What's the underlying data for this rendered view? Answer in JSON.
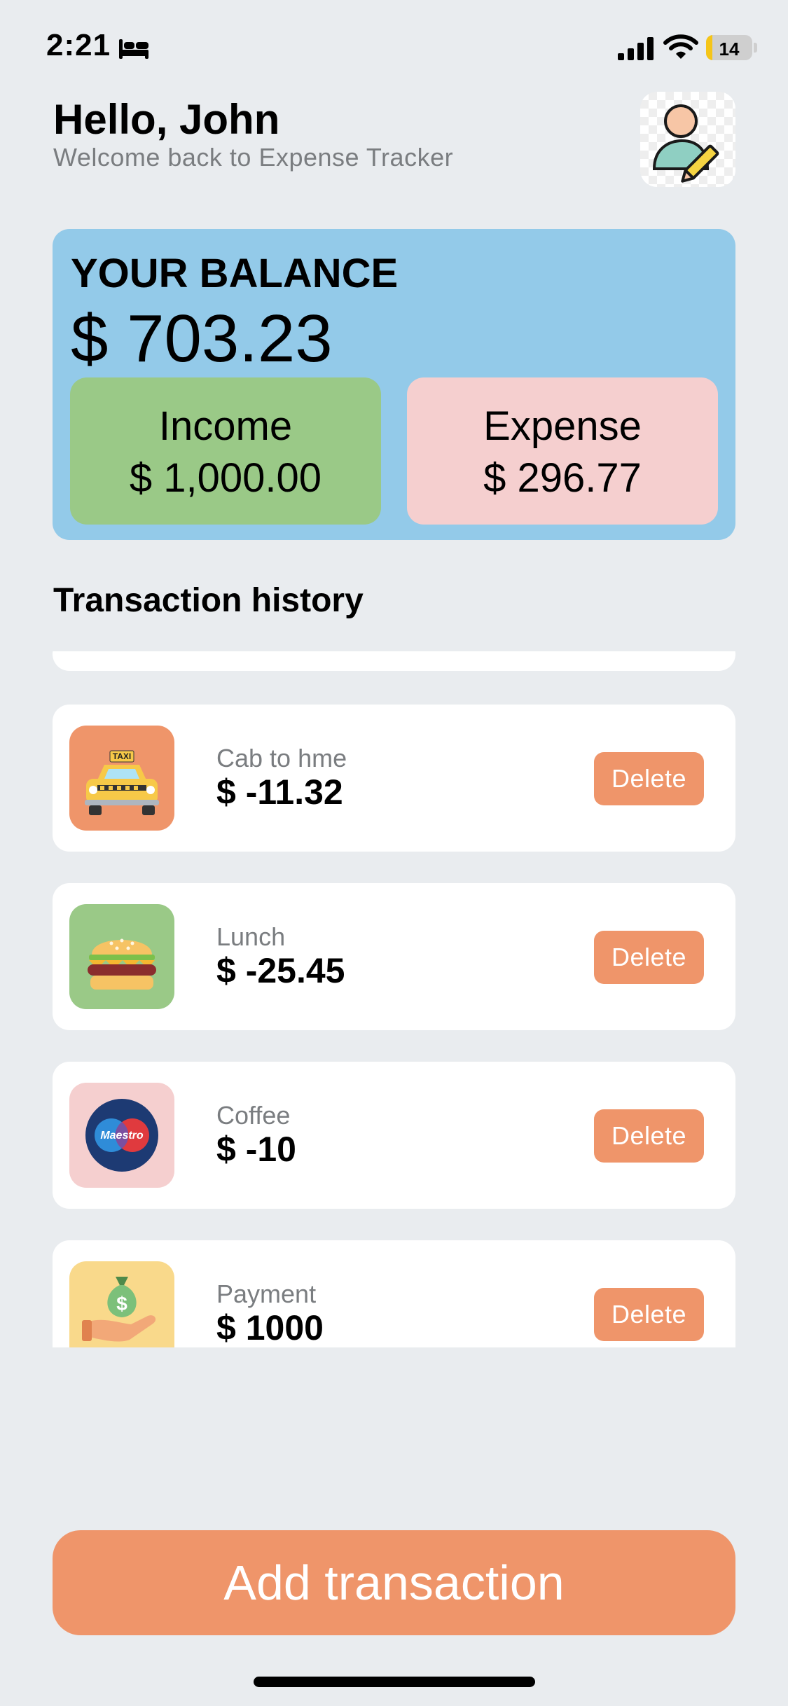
{
  "status_bar": {
    "time": "2:21",
    "battery_level": "14",
    "battery_color": "#f5c518",
    "icons": [
      "sleep-mode-bed-icon",
      "cellular-signal-icon",
      "wifi-icon",
      "battery-icon"
    ]
  },
  "header": {
    "greeting": "Hello, John",
    "subtitle": "Welcome back to Expense Tracker",
    "avatar_icon": "user-edit-icon"
  },
  "balance": {
    "label": "YOUR BALANCE",
    "value": "$ 703.23",
    "income_label": "Income",
    "income_value": "$ 1,000.00",
    "expense_label": "Expense",
    "expense_value": "$ 296.77"
  },
  "transactions": {
    "title": "Transaction history",
    "delete_label": "Delete",
    "items": [
      {
        "name": "Cab to hme",
        "amount": "$ -11.32",
        "icon": "taxi-icon",
        "icon_bg": "#ef956a"
      },
      {
        "name": "Lunch",
        "amount": "$ -25.45",
        "icon": "burger-icon",
        "icon_bg": "#9ac987"
      },
      {
        "name": "Coffee",
        "amount": "$ -10",
        "icon": "maestro-card-icon",
        "icon_bg": "#f5cfcf",
        "icon_text": "Maestro"
      },
      {
        "name": "Payment",
        "amount": "$ 1000",
        "icon": "money-bag-hand-icon",
        "icon_bg": "#f9d98b"
      }
    ]
  },
  "actions": {
    "add_transaction": "Add transaction"
  },
  "colors": {
    "background": "#e9ecef",
    "balance_card": "#93cae9",
    "income_card": "#9ac987",
    "expense_card": "#f5cfcf",
    "accent": "#ef956a"
  }
}
